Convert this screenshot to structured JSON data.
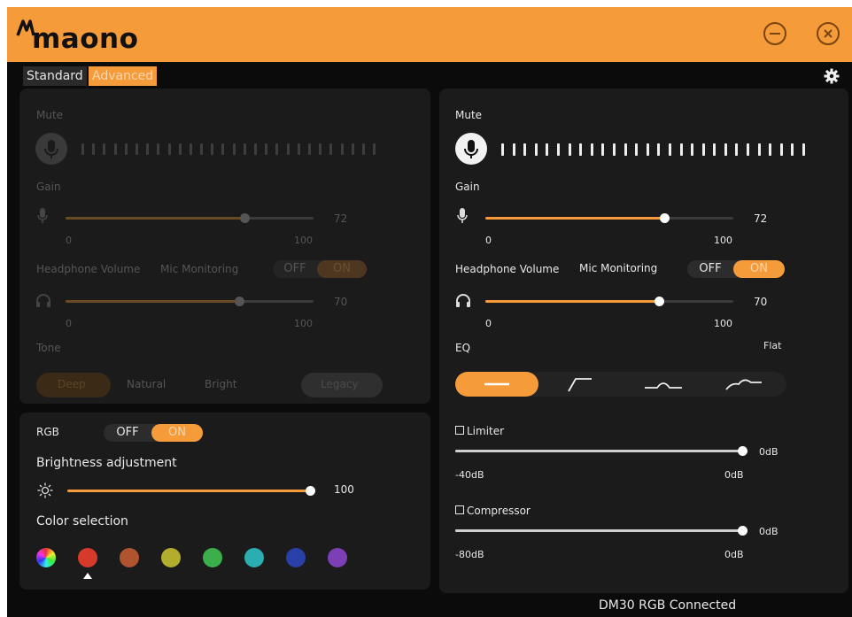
{
  "header": {
    "brand": "maono",
    "accent": "#f59b3a"
  },
  "tabs": {
    "standard": "Standard",
    "advanced": "Advanced"
  },
  "left": {
    "mute_label": "Mute",
    "gain": {
      "label": "Gain",
      "value": "72",
      "min": "0",
      "max": "100",
      "fraction": 0.72
    },
    "headphone": {
      "label": "Headphone Volume",
      "value": "70",
      "min": "0",
      "max": "100",
      "fraction": 0.7
    },
    "mic_monitoring": {
      "label": "Mic Monitoring",
      "off": "OFF",
      "on": "ON"
    },
    "tone": {
      "label": "Tone",
      "options": [
        "Deep",
        "Natural",
        "Bright"
      ],
      "legacy": "Legacy"
    }
  },
  "rgb": {
    "label": "RGB",
    "off": "OFF",
    "on": "ON",
    "brightness": {
      "label": "Brightness adjustment",
      "value": "100",
      "fraction": 1.0
    },
    "color_label": "Color selection",
    "colors": [
      "#d63a2b",
      "#b0532f",
      "#b3ad2e",
      "#3bb04a",
      "#2aaeb0",
      "#2b3fa8",
      "#7d3fb5"
    ],
    "selected": 1
  },
  "right": {
    "mute_label": "Mute",
    "gain": {
      "label": "Gain",
      "value": "72",
      "min": "0",
      "max": "100",
      "fraction": 0.72
    },
    "headphone": {
      "label": "Headphone Volume",
      "value": "70",
      "min": "0",
      "max": "100",
      "fraction": 0.7
    },
    "mic_monitoring": {
      "label": "Mic Monitoring",
      "off": "OFF",
      "on": "ON"
    },
    "eq": {
      "label": "EQ",
      "preset": "Flat"
    },
    "limiter": {
      "label": "Limiter",
      "value": "0dB",
      "min": "-40dB",
      "max": "0dB",
      "fraction": 1.0
    },
    "compressor": {
      "label": "Compressor",
      "value": "0dB",
      "min": "-80dB",
      "max": "0dB",
      "fraction": 1.0
    }
  },
  "status": {
    "text": "DM30 RGB Connected"
  }
}
